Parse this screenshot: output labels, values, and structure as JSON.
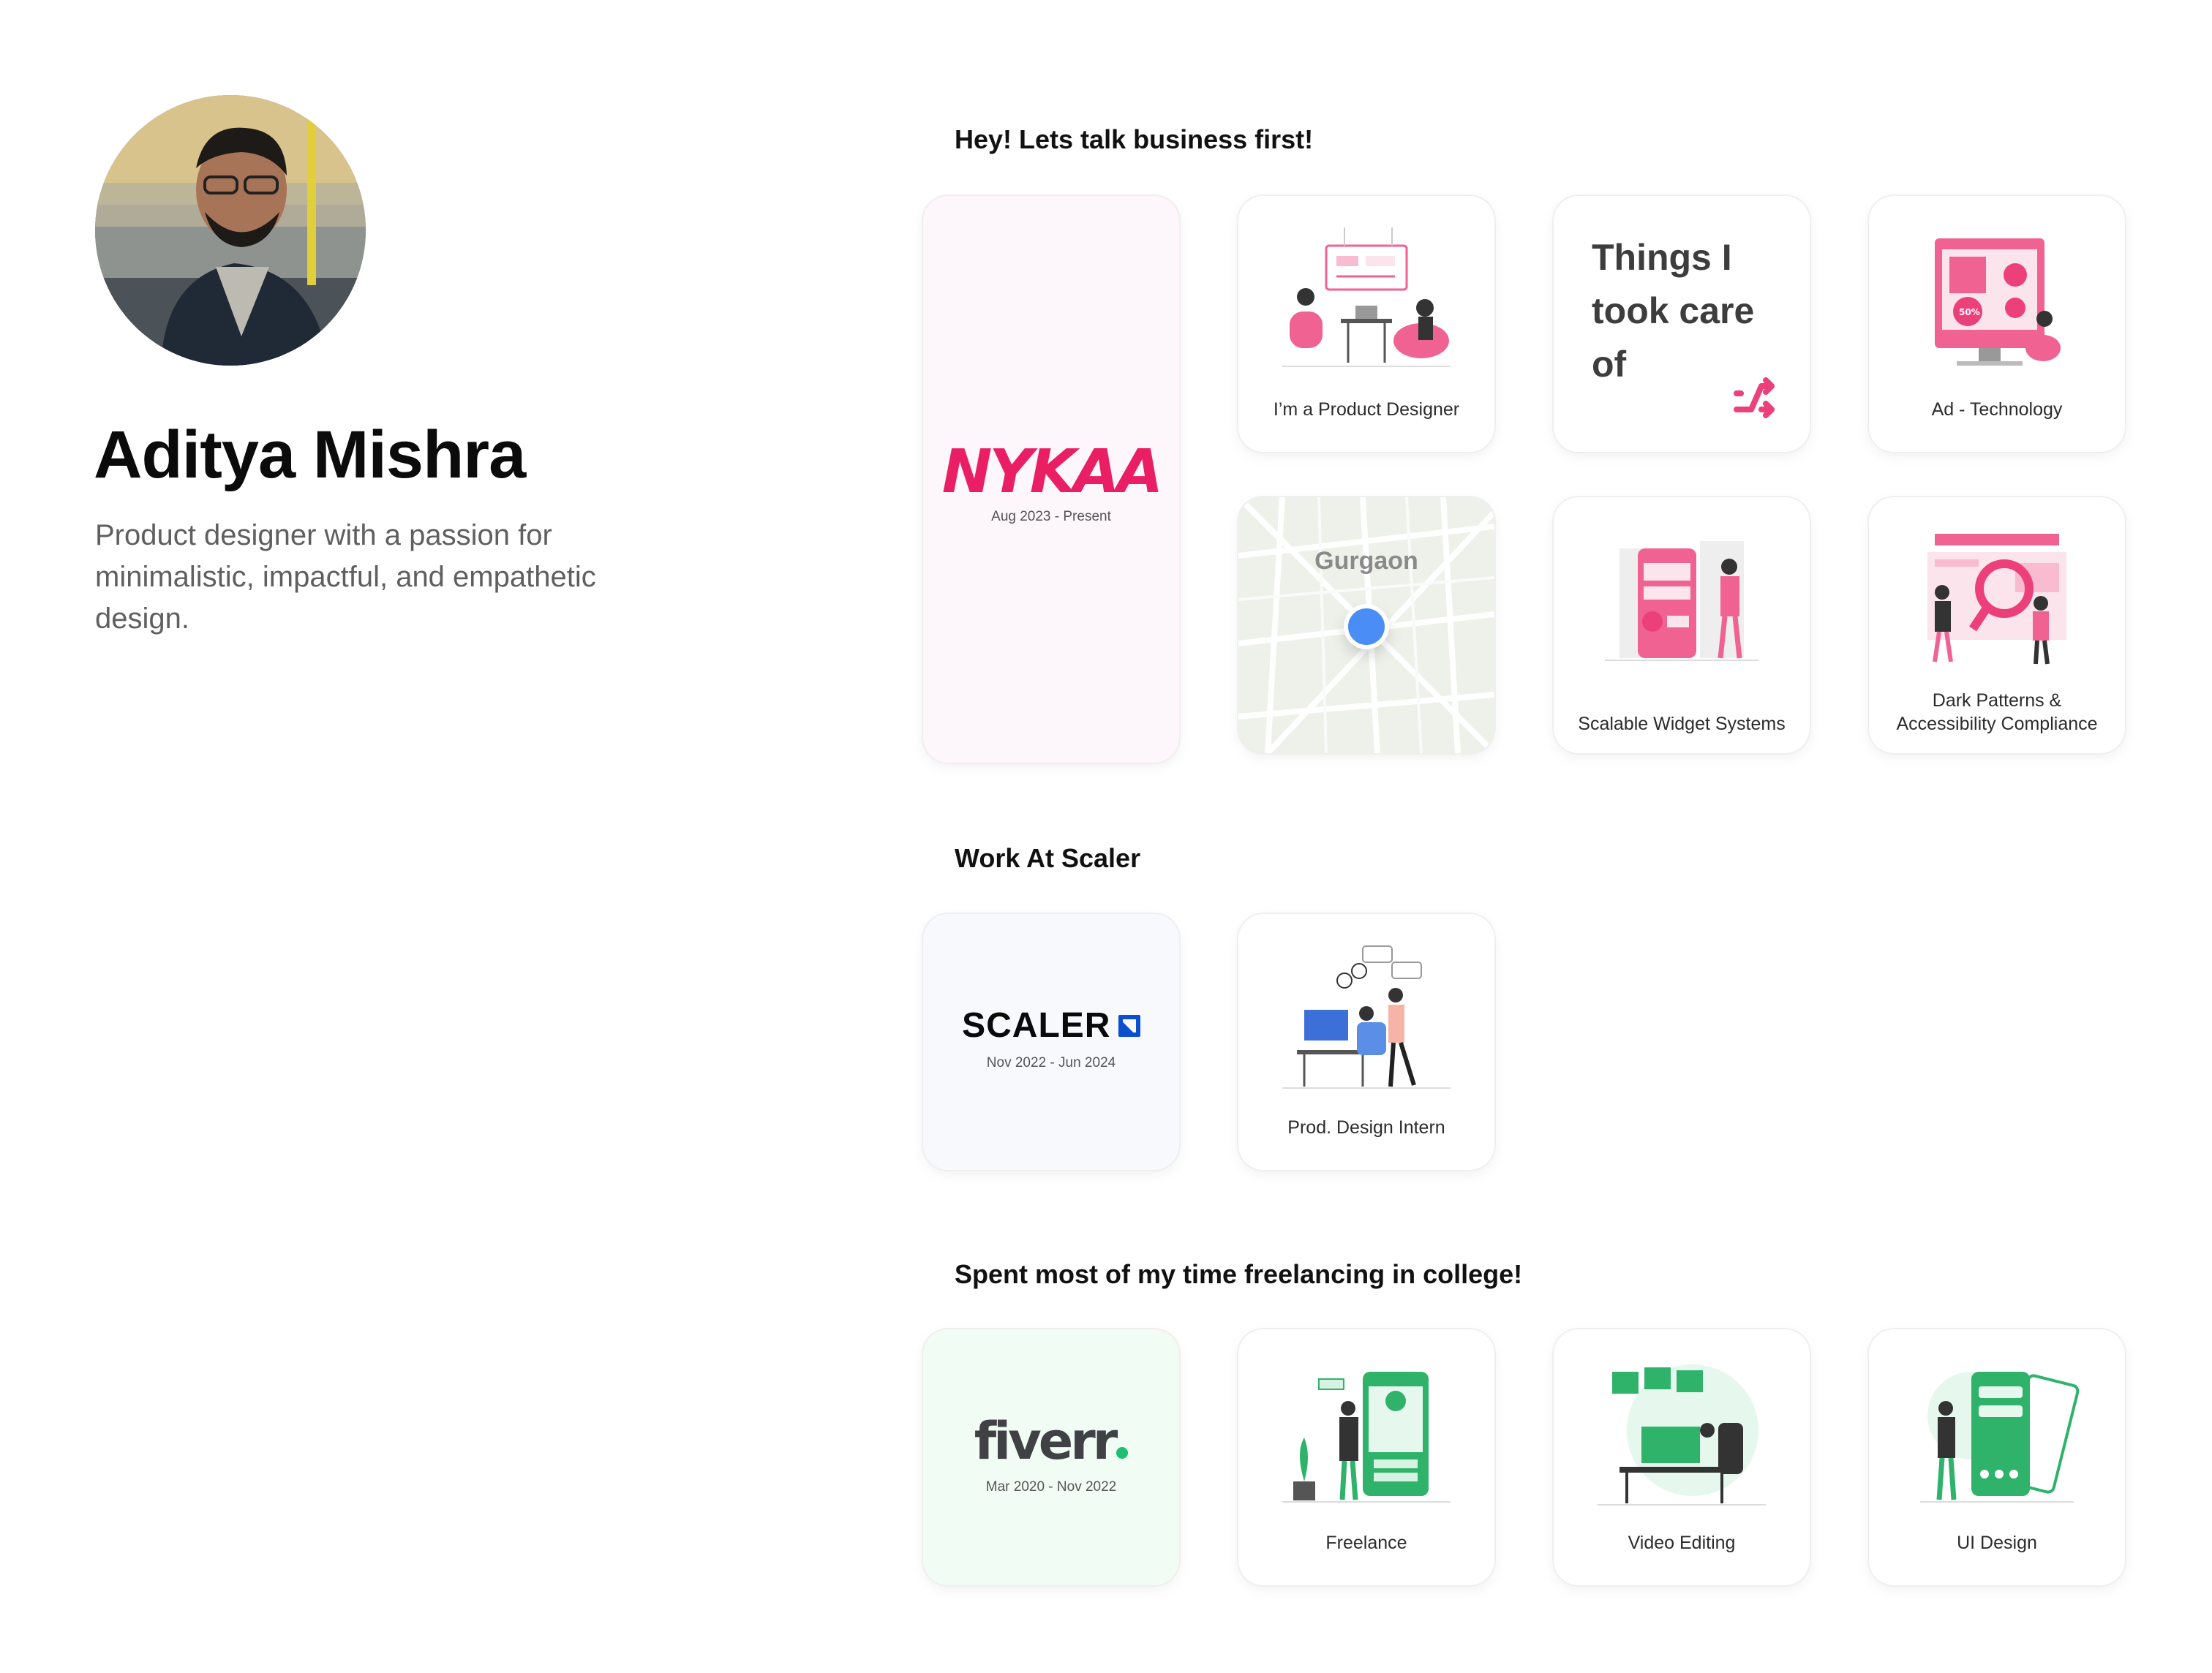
{
  "profile": {
    "name": "Aditya Mishra",
    "tagline": "Product designer with a passion for minimalistic, impactful, and empathetic design."
  },
  "sections": {
    "business": "Hey! Lets talk business first!",
    "scaler": "Work At Scaler",
    "freelance": "Spent most of my time freelancing in college!"
  },
  "nykaa": {
    "logo": "NYKAA",
    "date": "Aug 2023 - Present",
    "bg": "#fdf6fa",
    "accent": "#e91e63"
  },
  "cards_business": {
    "product_designer": "I’m a Product Designer",
    "things": "Things I took care of",
    "ad_tech": "Ad - Technology",
    "map": "Gurgaon",
    "widgets": "Scalable Widget Systems",
    "dark_patterns": "Dark Patterns & Accessibility Compliance"
  },
  "scaler": {
    "logo": "SCALER",
    "date": "Nov 2022 - Jun 2024",
    "bg": "#f7f9fd",
    "accent": "#0b4fcf"
  },
  "cards_scaler": {
    "intern": "Prod. Design Intern"
  },
  "fiverr": {
    "logo": "fiverr",
    "date": "Mar 2020 - Nov 2022",
    "bg": "#f1fcf4",
    "accent": "#1dbf73"
  },
  "cards_freelance": {
    "freelance": "Freelance",
    "video": "Video Editing",
    "ui": "UI Design"
  },
  "colors": {
    "pink": "#f06292",
    "green": "#2fb36b",
    "map_dot": "#4a8df6"
  }
}
